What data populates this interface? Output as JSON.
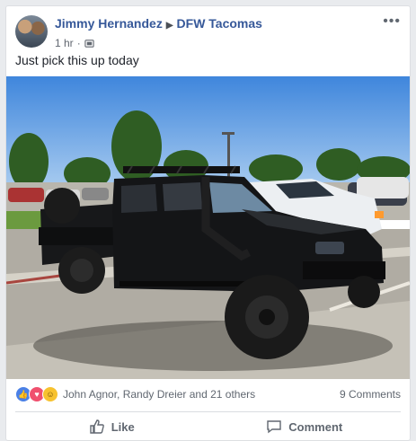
{
  "post": {
    "author": "Jimmy Hernandez",
    "group": "DFW Tacomas",
    "time": "1 hr",
    "separator": "·",
    "text": "Just pick this up today",
    "more_icon": "•••"
  },
  "reactions": {
    "icons": [
      "like-icon",
      "love-icon",
      "haha-icon"
    ],
    "names": "John Agnor, Randy Dreier and 21 others",
    "comments": "9 Comments"
  },
  "actions": {
    "like": "Like",
    "comment": "Comment"
  },
  "colors": {
    "link": "#365899",
    "truck": "#141517",
    "sky": "#4b8fdb"
  }
}
